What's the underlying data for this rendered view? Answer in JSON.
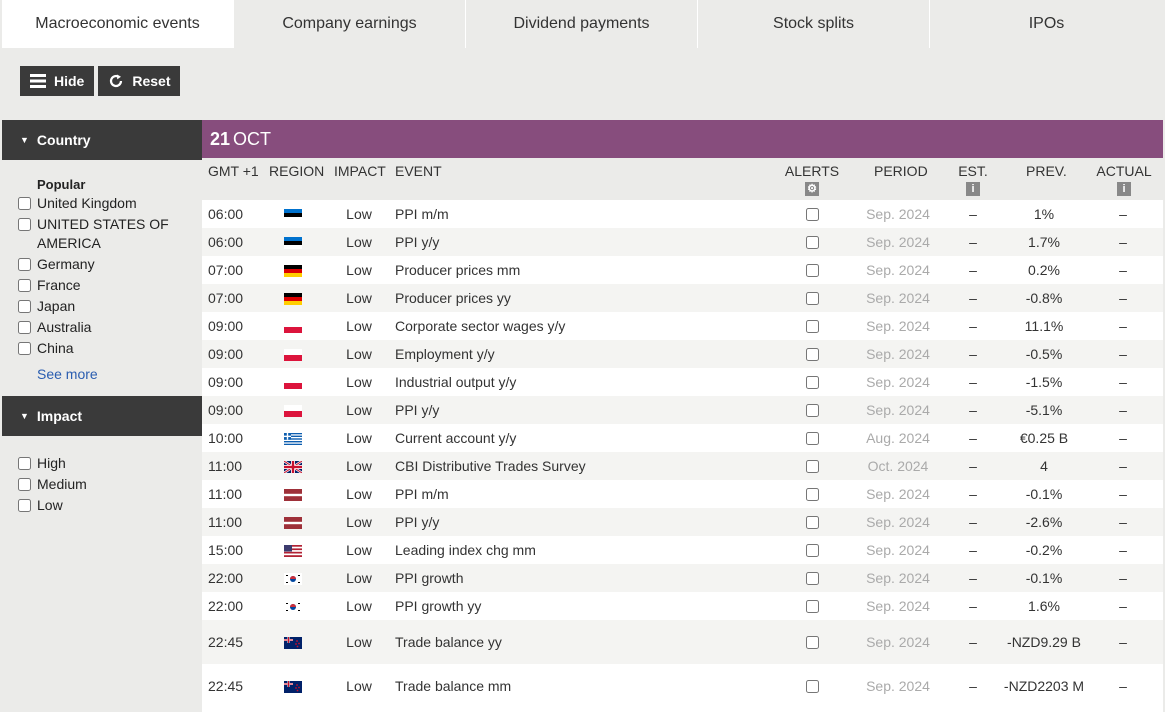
{
  "tabs": [
    {
      "label": "Macroeconomic events",
      "active": true
    },
    {
      "label": "Company earnings",
      "active": false
    },
    {
      "label": "Dividend payments",
      "active": false
    },
    {
      "label": "Stock splits",
      "active": false
    },
    {
      "label": "IPOs",
      "active": false
    }
  ],
  "toolbar": {
    "hide_label": "Hide",
    "reset_label": "Reset"
  },
  "sidebar": {
    "country_title": "Country",
    "popular_title": "Popular",
    "countries": [
      "United Kingdom",
      "UNITED STATES OF AMERICA",
      "Germany",
      "France",
      "Japan",
      "Australia",
      "China"
    ],
    "see_more": "See more",
    "impact_title": "Impact",
    "impacts": [
      "High",
      "Medium",
      "Low"
    ]
  },
  "date": {
    "day": "21",
    "month": "OCT"
  },
  "columns": {
    "time": "GMT +1",
    "region": "REGION",
    "impact": "IMPACT",
    "event": "EVENT",
    "alerts": "ALERTS",
    "period": "PERIOD",
    "est": "EST.",
    "prev": "PREV.",
    "actual": "ACTUAL",
    "info_glyph": "i"
  },
  "colors": {
    "accent": "#874d7d",
    "dark": "#3a3a3a"
  },
  "rows": [
    {
      "time": "06:00",
      "flag": "EE",
      "impact": "Low",
      "event": "PPI m/m",
      "period": "Sep. 2024",
      "est": "–",
      "prev": "1%",
      "actual": "–"
    },
    {
      "time": "06:00",
      "flag": "EE",
      "impact": "Low",
      "event": "PPI y/y",
      "period": "Sep. 2024",
      "est": "–",
      "prev": "1.7%",
      "actual": "–"
    },
    {
      "time": "07:00",
      "flag": "DE",
      "impact": "Low",
      "event": "Producer prices mm",
      "period": "Sep. 2024",
      "est": "–",
      "prev": "0.2%",
      "actual": "–"
    },
    {
      "time": "07:00",
      "flag": "DE",
      "impact": "Low",
      "event": "Producer prices yy",
      "period": "Sep. 2024",
      "est": "–",
      "prev": "-0.8%",
      "actual": "–"
    },
    {
      "time": "09:00",
      "flag": "PL",
      "impact": "Low",
      "event": "Corporate sector wages y/y",
      "period": "Sep. 2024",
      "est": "–",
      "prev": "11.1%",
      "actual": "–"
    },
    {
      "time": "09:00",
      "flag": "PL",
      "impact": "Low",
      "event": "Employment y/y",
      "period": "Sep. 2024",
      "est": "–",
      "prev": "-0.5%",
      "actual": "–"
    },
    {
      "time": "09:00",
      "flag": "PL",
      "impact": "Low",
      "event": "Industrial output y/y",
      "period": "Sep. 2024",
      "est": "–",
      "prev": "-1.5%",
      "actual": "–"
    },
    {
      "time": "09:00",
      "flag": "PL",
      "impact": "Low",
      "event": "PPI y/y",
      "period": "Sep. 2024",
      "est": "–",
      "prev": "-5.1%",
      "actual": "–"
    },
    {
      "time": "10:00",
      "flag": "GR",
      "impact": "Low",
      "event": "Current account y/y",
      "period": "Aug. 2024",
      "est": "–",
      "prev": "€0.25 B",
      "actual": "–"
    },
    {
      "time": "11:00",
      "flag": "GB",
      "impact": "Low",
      "event": "CBI Distributive Trades Survey",
      "period": "Oct. 2024",
      "est": "–",
      "prev": "4",
      "actual": "–"
    },
    {
      "time": "11:00",
      "flag": "LV",
      "impact": "Low",
      "event": "PPI m/m",
      "period": "Sep. 2024",
      "est": "–",
      "prev": "-0.1%",
      "actual": "–"
    },
    {
      "time": "11:00",
      "flag": "LV",
      "impact": "Low",
      "event": "PPI y/y",
      "period": "Sep. 2024",
      "est": "–",
      "prev": "-2.6%",
      "actual": "–"
    },
    {
      "time": "15:00",
      "flag": "US",
      "impact": "Low",
      "event": "Leading index chg mm",
      "period": "Sep. 2024",
      "est": "–",
      "prev": "-0.2%",
      "actual": "–"
    },
    {
      "time": "22:00",
      "flag": "KR",
      "impact": "Low",
      "event": "PPI growth",
      "period": "Sep. 2024",
      "est": "–",
      "prev": "-0.1%",
      "actual": "–"
    },
    {
      "time": "22:00",
      "flag": "KR",
      "impact": "Low",
      "event": "PPI growth yy",
      "period": "Sep. 2024",
      "est": "–",
      "prev": "1.6%",
      "actual": "–"
    },
    {
      "time": "22:45",
      "flag": "NZ",
      "impact": "Low",
      "event": "Trade balance yy",
      "period": "Sep. 2024",
      "est": "–",
      "prev": "-NZD9.29 B",
      "actual": "–"
    },
    {
      "time": "22:45",
      "flag": "NZ",
      "impact": "Low",
      "event": "Trade balance mm",
      "period": "Sep. 2024",
      "est": "–",
      "prev": "-NZD2203 M",
      "actual": "–"
    }
  ]
}
